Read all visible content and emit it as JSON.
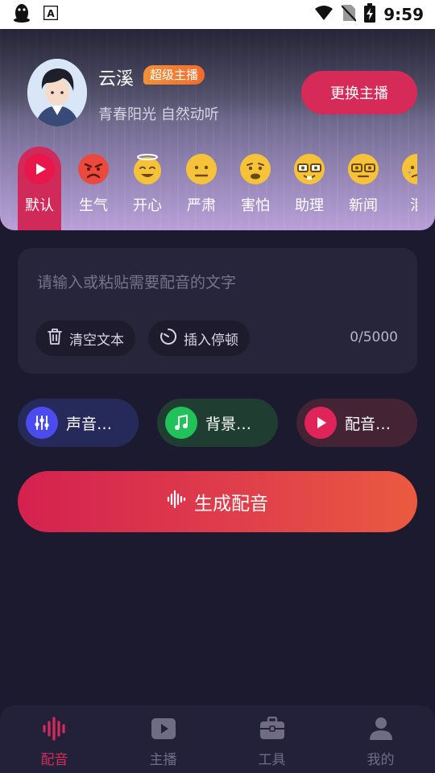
{
  "status_bar": {
    "time": "9:59"
  },
  "anchor": {
    "name": "云溪",
    "badge": "超级主播",
    "description": "青春阳光 自然动听",
    "change_button": "更换主播"
  },
  "moods": [
    {
      "label": "默认",
      "active": true,
      "icon": "play-icon"
    },
    {
      "label": "生气",
      "icon": "angry-face-icon"
    },
    {
      "label": "开心",
      "icon": "happy-face-icon"
    },
    {
      "label": "严肃",
      "icon": "serious-face-icon"
    },
    {
      "label": "害怕",
      "icon": "scared-face-icon"
    },
    {
      "label": "助理",
      "icon": "nerd-face-icon"
    },
    {
      "label": "新闻",
      "icon": "glasses-face-icon"
    },
    {
      "label": "泪",
      "icon": "crying-face-icon"
    }
  ],
  "editor": {
    "placeholder": "请输入或粘贴需要配音的文字",
    "clear_label": "清空文本",
    "pause_label": "插入停顿",
    "counter": "0/5000"
  },
  "features": [
    {
      "label": "声音…",
      "icon": "equalizer-icon",
      "color": "#4a4cf0"
    },
    {
      "label": "背景…",
      "icon": "music-note-icon",
      "color": "#22c25a"
    },
    {
      "label": "配音…",
      "icon": "play-icon",
      "color": "#e0245a"
    }
  ],
  "generate_button": "生成配音",
  "tabs": [
    {
      "label": "配音",
      "active": true,
      "icon": "waveform-icon"
    },
    {
      "label": "主播",
      "icon": "video-play-icon"
    },
    {
      "label": "工具",
      "icon": "toolbox-icon"
    },
    {
      "label": "我的",
      "icon": "person-icon"
    }
  ],
  "colors": {
    "accent": "#d62a59",
    "background": "#1c1a2e",
    "card": "#27253a"
  }
}
